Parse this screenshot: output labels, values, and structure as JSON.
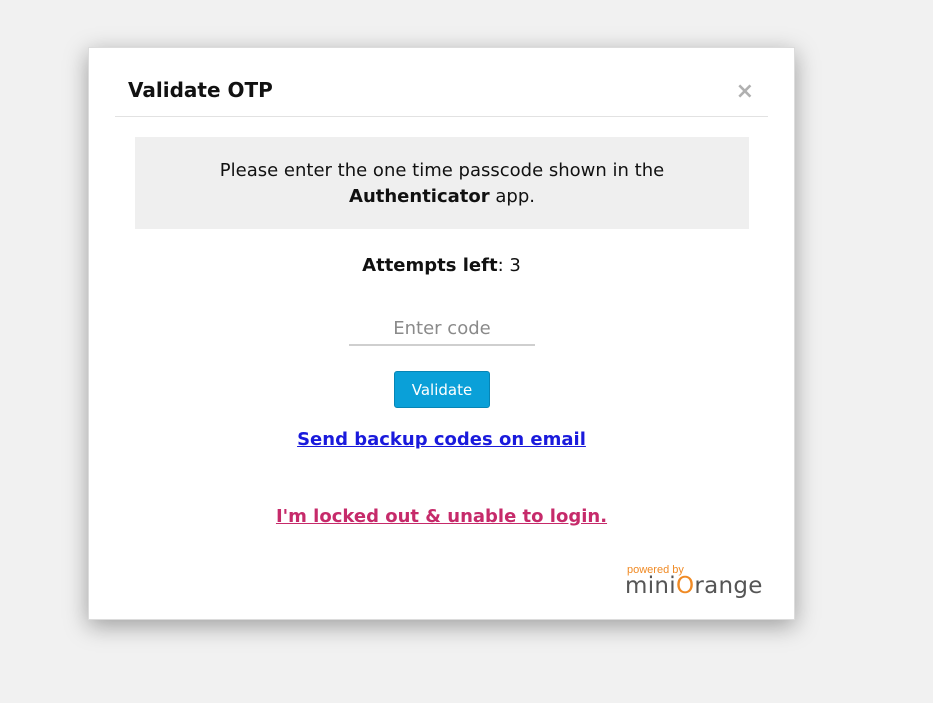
{
  "dialog": {
    "title": "Validate OTP",
    "close_glyph": "×"
  },
  "message": {
    "prefix": "Please enter the one time passcode shown in the ",
    "app_name": "Authenticator",
    "suffix": " app."
  },
  "attempts": {
    "label": "Attempts left",
    "separator": ": ",
    "value": "3"
  },
  "otp_input": {
    "placeholder": "Enter code",
    "value": ""
  },
  "validate_button": {
    "label": "Validate"
  },
  "links": {
    "backup": "Send backup codes on email",
    "locked_out": "I'm locked out & unable to login."
  },
  "branding": {
    "powered_by": "powered by",
    "brand_part1": "mini",
    "brand_o": "O",
    "brand_part2": "range"
  },
  "colors": {
    "primary_button": "#0aa0d8",
    "backup_link": "#1a1adc",
    "locked_link": "#c62a6a",
    "brand_accent": "#f08a24",
    "message_bg": "#efefef"
  }
}
